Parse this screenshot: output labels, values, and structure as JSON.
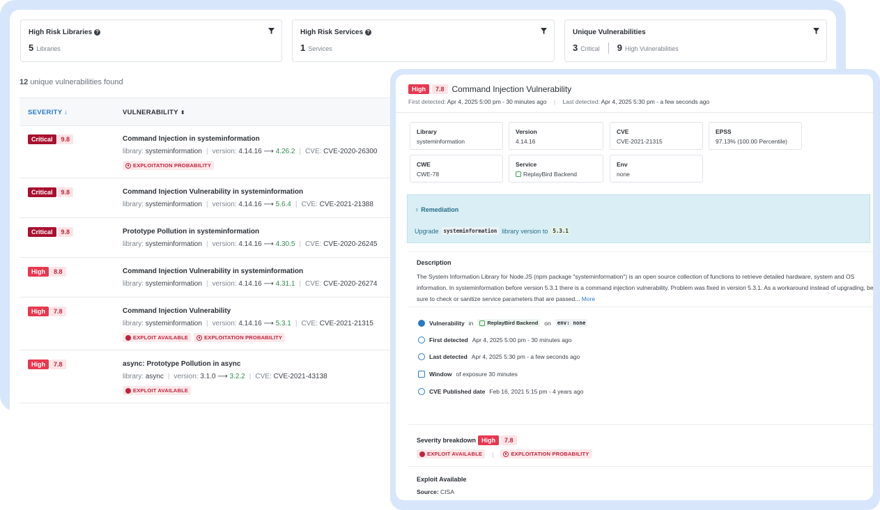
{
  "cards": [
    {
      "title": "High Risk Libraries",
      "count": "5",
      "unit": "Libraries"
    },
    {
      "title": "High Risk Services",
      "count": "1",
      "unit": "Services"
    },
    {
      "title": "Unique Vulnerabilities",
      "count": "3",
      "unit": "Critical",
      "count2": "9",
      "unit2": "High Vulnerabilities"
    }
  ],
  "found": {
    "count": "12",
    "text": "unique vulnerabilities found"
  },
  "table": {
    "col_severity": "SEVERITY",
    "col_vulnerability": "VULNERABILITY",
    "rows": [
      {
        "severity": "Critical",
        "score": "9.8",
        "title": "Command Injection in systeminformation",
        "lib_label": "library:",
        "library": "systeminformation",
        "ver_label": "version:",
        "from": "4.14.16",
        "arrow": "⟶",
        "to": "4.26.2",
        "cve_label": "CVE:",
        "cve": "CVE-2020-26300",
        "tags": [
          "EXPLOITATION PROBABILITY"
        ]
      },
      {
        "severity": "Critical",
        "score": "9.8",
        "title": "Command Injection Vulnerability in systeminformation",
        "lib_label": "library:",
        "library": "systeminformation",
        "ver_label": "version:",
        "from": "4.14.16",
        "arrow": "⟶",
        "to": "5.6.4",
        "cve_label": "CVE:",
        "cve": "CVE-2021-21388",
        "tags": []
      },
      {
        "severity": "Critical",
        "score": "9.8",
        "title": "Prototype Pollution in systeminformation",
        "lib_label": "library:",
        "library": "systeminformation",
        "ver_label": "version:",
        "from": "4.14.16",
        "arrow": "⟶",
        "to": "4.30.5",
        "cve_label": "CVE:",
        "cve": "CVE-2020-26245",
        "tags": []
      },
      {
        "severity": "High",
        "score": "8.8",
        "title": "Command Injection Vulnerability in systeminformation",
        "lib_label": "library:",
        "library": "systeminformation",
        "ver_label": "version:",
        "from": "4.14.16",
        "arrow": "⟶",
        "to": "4.31.1",
        "cve_label": "CVE:",
        "cve": "CVE-2020-26274",
        "tags": []
      },
      {
        "severity": "High",
        "score": "7.8",
        "title": "Command Injection Vulnerability",
        "lib_label": "library:",
        "library": "systeminformation",
        "ver_label": "version:",
        "from": "4.14.16",
        "arrow": "⟶",
        "to": "5.3.1",
        "cve_label": "CVE:",
        "cve": "CVE-2021-21315",
        "tags": [
          "EXPLOIT AVAILABLE",
          "EXPLOITATION PROBABILITY"
        ]
      },
      {
        "severity": "High",
        "score": "7.8",
        "title": "async: Prototype Pollution in async",
        "lib_label": "library:",
        "library": "async",
        "ver_label": "version:",
        "from": "3.1.0",
        "arrow": "⟶",
        "to": "3.2.2",
        "cve_label": "CVE:",
        "cve": "CVE-2021-43138",
        "tags": [
          "EXPLOIT AVAILABLE"
        ]
      }
    ]
  },
  "detail": {
    "severity": "High",
    "score": "7.8",
    "title": "Command Injection Vulnerability",
    "first_label": "First detected:",
    "first": "Apr 4, 2025 5:00 pm - 30 minutes ago",
    "last_label": "Last detected:",
    "last": "Apr 4, 2025 5:30 pm - a few seconds ago",
    "fields": [
      {
        "k": "Library",
        "v": "systeminformation"
      },
      {
        "k": "Version",
        "v": "4.14.16"
      },
      {
        "k": "CVE",
        "v": "CVE-2021-21315"
      },
      {
        "k": "EPSS",
        "v": "97.13% (100.00 Percentile)"
      },
      {
        "k": "CWE",
        "v": "CWE-78"
      },
      {
        "k": "Service",
        "v": "ReplayBird Backend"
      },
      {
        "k": "Env",
        "v": "none"
      }
    ],
    "remediation": {
      "heading": "Remediation",
      "upgrade": "Upgrade",
      "library": "systeminformation",
      "mid": "library version to",
      "version": "5.3.1"
    },
    "description_heading": "Description",
    "description": "The System Information Library for Node.JS (npm package \"systeminformation\") is an open source collection of functions to retrieve detailed hardware, system and OS information. In systeminformation before version 5.3.1 there is a command injection vulnerability. Problem was fixed in version 5.3.1. As a workaround instead of upgrading, be sure to check or sanitize service parameters that are passed...",
    "more": "More",
    "facts": {
      "vuln_label": "Vulnerability",
      "vuln_in": "in",
      "service": "ReplayBird Backend",
      "on": "on",
      "env": "env: none",
      "first_label": "First detected",
      "first": "Apr 4, 2025 5:00 pm - 30 minutes ago",
      "last_label": "Last detected",
      "last": "Apr 4, 2025 5:30 pm - a few seconds ago",
      "window_label": "Window",
      "window": "of exposure 30 minutes",
      "published_label": "CVE Published date",
      "published": "Feb 16, 2021 5:15 pm - 4 years ago"
    },
    "breakdown_label": "Severity breakdown",
    "breakdown_tags": [
      "EXPLOIT AVAILABLE",
      "EXPLOITATION PROBABILITY"
    ],
    "exploit_heading": "Exploit Available",
    "source_label": "Source:",
    "source": "CISA"
  }
}
